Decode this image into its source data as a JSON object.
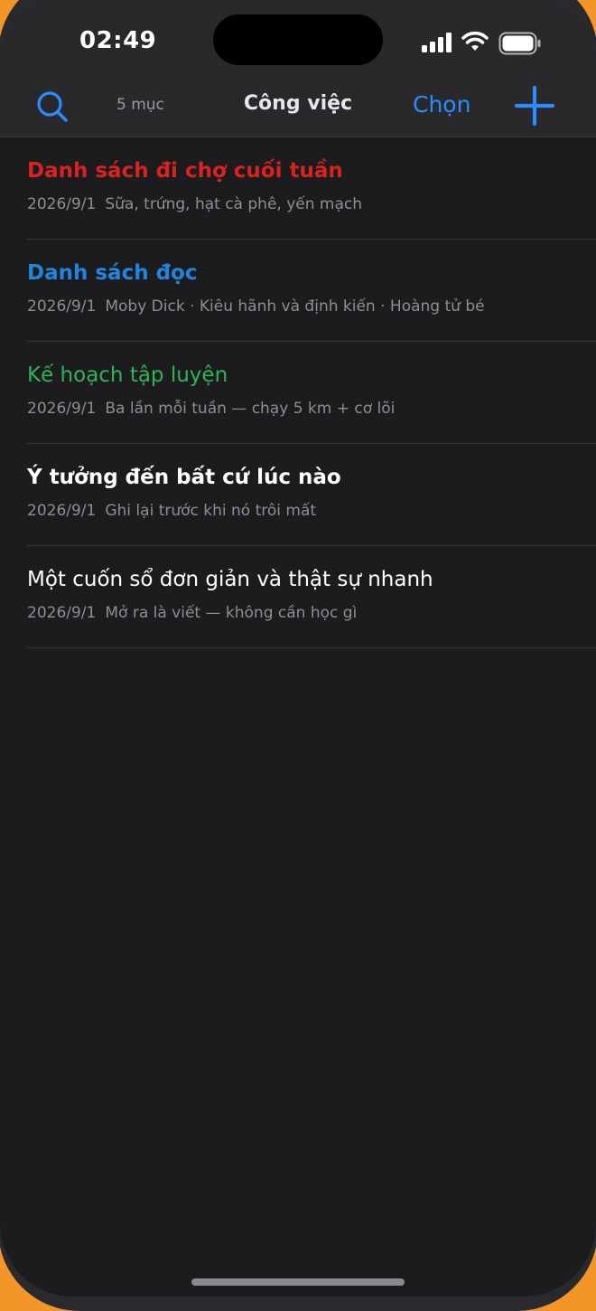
{
  "status_bar": {
    "time": "02:49",
    "signal_icon": "signal-icon",
    "wifi_icon": "wifi-icon",
    "battery_icon": "battery-icon"
  },
  "nav": {
    "search_icon": "search-icon",
    "count": "5 mục",
    "title": "Công việc",
    "select_label": "Chọn",
    "add_icon": "plus-icon"
  },
  "colors": {
    "accent": "#2a8cff",
    "background": "#1c1c1e",
    "red": "#d9231f",
    "blue": "#1f86e0",
    "green": "#2fb45a",
    "white": "#ffffff"
  },
  "notes": [
    {
      "title": "Danh sách đi chợ cuối tuần",
      "date": "2026/9/1",
      "preview": "Sữa, trứng, hạt cà phê, yến mạch",
      "color": "#d9231f",
      "bold": true
    },
    {
      "title": "Danh sách đọc",
      "date": "2026/9/1",
      "preview": "Moby Dick · Kiêu hãnh và định kiến · Hoàng tử bé",
      "color": "#1f86e0",
      "bold": true
    },
    {
      "title": "Kế hoạch tập luyện",
      "date": "2026/9/1",
      "preview": "Ba lần mỗi tuần — chạy 5 km + cơ lõi",
      "color": "#2fb45a",
      "bold": false
    },
    {
      "title": "Ý tưởng đến bất cứ lúc nào",
      "date": "2026/9/1",
      "preview": "Ghi lại trước khi nó trôi mất",
      "color": "#ffffff",
      "bold": true
    },
    {
      "title": "Một cuốn sổ đơn giản và thật sự nhanh",
      "date": "2026/9/1",
      "preview": "Mở ra là viết — không cần học gì",
      "color": "#ffffff",
      "bold": false
    }
  ]
}
